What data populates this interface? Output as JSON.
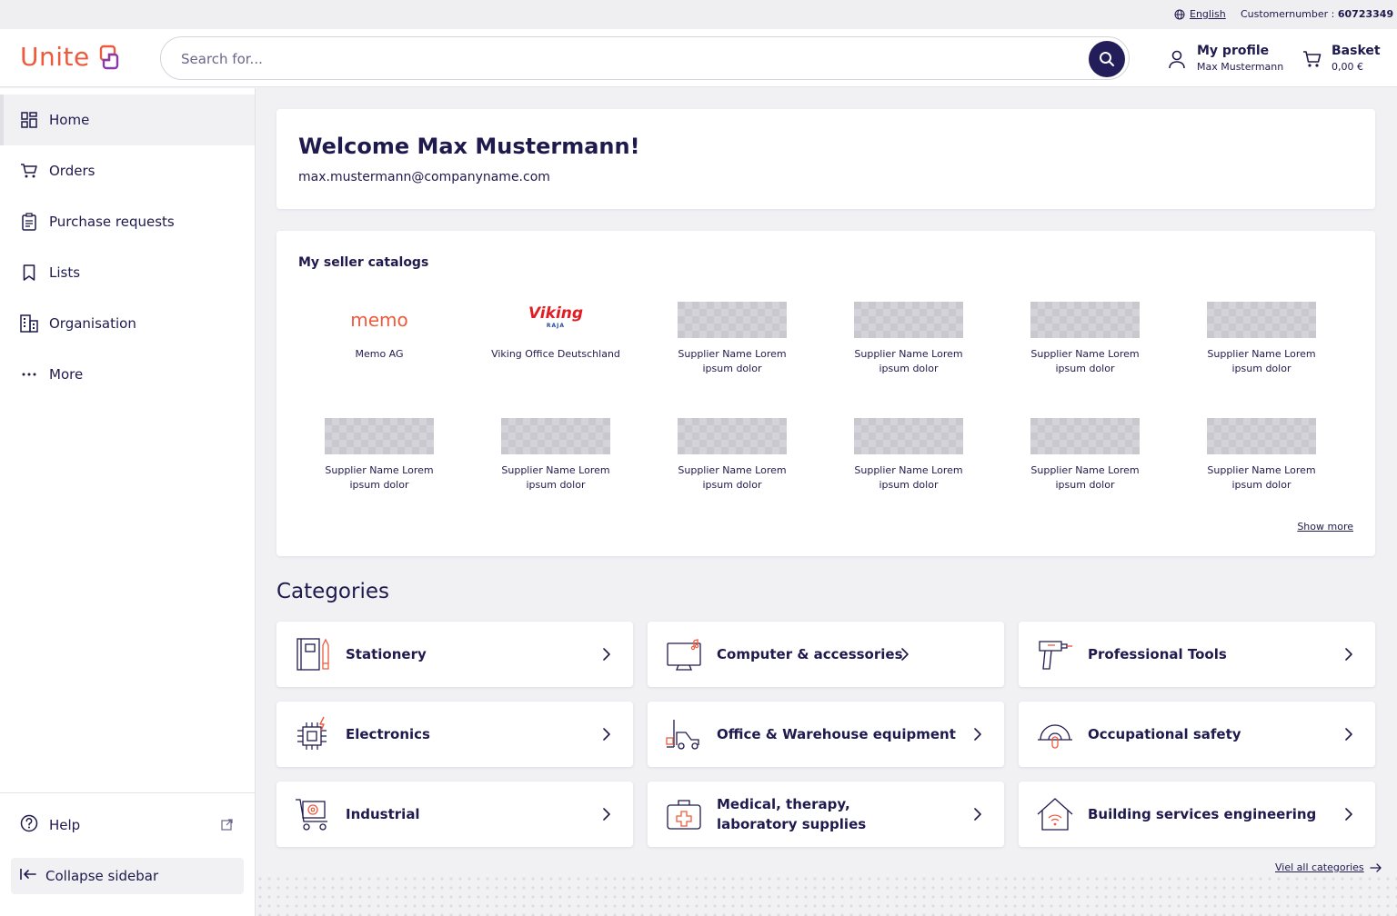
{
  "topbar": {
    "language": "English",
    "customer_label": "Customernumber :",
    "customer_number": "60723349"
  },
  "header": {
    "logo_text": "Unite",
    "search_placeholder": "Search for...",
    "profile_title": "My profile",
    "profile_name": "Max Mustermann",
    "basket_title": "Basket",
    "basket_total": "0,00 €"
  },
  "sidebar": {
    "items": [
      {
        "label": "Home",
        "icon": "dashboard-icon"
      },
      {
        "label": "Orders",
        "icon": "cart-icon"
      },
      {
        "label": "Purchase requests",
        "icon": "clipboard-icon"
      },
      {
        "label": "Lists",
        "icon": "bookmark-icon"
      },
      {
        "label": "Organisation",
        "icon": "building-icon"
      },
      {
        "label": "More",
        "icon": "more-icon"
      }
    ],
    "help": "Help",
    "collapse": "Collapse sidebar"
  },
  "welcome": {
    "title": "Welcome Max Mustermann!",
    "email": "max.mustermann@companyname.com"
  },
  "catalogs": {
    "title": "My seller catalogs",
    "memo_logo": "memo",
    "viking_logo": "Viking",
    "viking_sub": "RAJA",
    "sellers": [
      {
        "name1": "Memo AG",
        "name2": ""
      },
      {
        "name1": "Viking Office Deutschland",
        "name2": ""
      },
      {
        "name1": "Supplier Name Lorem",
        "name2": "ipsum dolor"
      },
      {
        "name1": "Supplier Name Lorem",
        "name2": "ipsum dolor"
      },
      {
        "name1": "Supplier Name Lorem",
        "name2": "ipsum dolor"
      },
      {
        "name1": "Supplier Name Lorem",
        "name2": "ipsum dolor"
      },
      {
        "name1": "Supplier Name Lorem",
        "name2": "ipsum dolor"
      },
      {
        "name1": "Supplier Name Lorem",
        "name2": "ipsum dolor"
      },
      {
        "name1": "Supplier Name Lorem",
        "name2": "ipsum dolor"
      },
      {
        "name1": "Supplier Name Lorem",
        "name2": "ipsum dolor"
      },
      {
        "name1": "Supplier Name Lorem",
        "name2": "ipsum dolor"
      },
      {
        "name1": "Supplier Name Lorem",
        "name2": "ipsum dolor"
      }
    ],
    "show_more": "Show more"
  },
  "categories": {
    "title": "Categories",
    "items": [
      {
        "label": "Stationery",
        "icon": "notebook-pencil-icon"
      },
      {
        "label": "Computer & accessories",
        "icon": "monitor-icon"
      },
      {
        "label": "Professional Tools",
        "icon": "drill-icon"
      },
      {
        "label": "Electronics",
        "icon": "chip-icon"
      },
      {
        "label": "Office & Warehouse equipment",
        "icon": "forklift-icon"
      },
      {
        "label": "Occupational safety",
        "icon": "helmet-icon"
      },
      {
        "label": "Industrial",
        "icon": "trolley-gear-icon"
      },
      {
        "label": "Medical, therapy, laboratory supplies",
        "icon": "medical-case-icon"
      },
      {
        "label": "Building services engineering",
        "icon": "house-wifi-icon"
      }
    ],
    "view_all": "Viel all categories"
  },
  "colors": {
    "brand_navy": "#1f1a4d",
    "accent_orange": "#ee5a3c",
    "accent_purple": "#8a3aa8"
  }
}
